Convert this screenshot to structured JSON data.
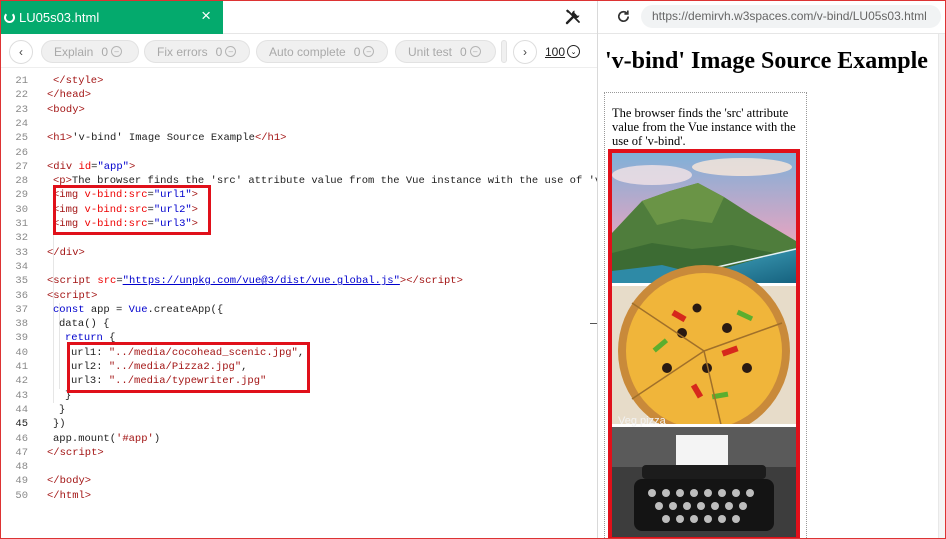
{
  "editor": {
    "tab_title": "LU05s03.html",
    "tab_close": "×",
    "tools_icon": "tools-icon"
  },
  "toolbar": {
    "prev": "‹",
    "next": "›",
    "buttons": [
      {
        "label": "Explain",
        "count": "0"
      },
      {
        "label": "Fix errors",
        "count": "0"
      },
      {
        "label": "Auto complete",
        "count": "0"
      },
      {
        "label": "Unit test",
        "count": "0"
      }
    ],
    "zoom": "100"
  },
  "code_lines": [
    {
      "n": "21",
      "indent": 1,
      "html": "<span class=\"t\">&lt;/style&gt;</span>"
    },
    {
      "n": "22",
      "indent": 0,
      "html": "<span class=\"t\">&lt;/head&gt;</span>"
    },
    {
      "n": "23",
      "indent": 0,
      "html": "<span class=\"t\">&lt;body&gt;</span>"
    },
    {
      "n": "24",
      "indent": 0,
      "html": ""
    },
    {
      "n": "25",
      "indent": 0,
      "html": "<span class=\"t\">&lt;h1&gt;</span>'v-bind' Image Source Example<span class=\"t\">&lt;/h1&gt;</span>"
    },
    {
      "n": "26",
      "indent": 0,
      "html": ""
    },
    {
      "n": "27",
      "indent": 0,
      "html": "<span class=\"t\">&lt;div</span> <span class=\"a\">id</span>=<span class=\"s\">\"app\"</span><span class=\"t\">&gt;</span>"
    },
    {
      "n": "28",
      "indent": 1,
      "html": "<span class=\"t\">&lt;p&gt;</span>The browser finds the 'src' attribute value from the Vue instance with the use of 'v-bind'.<span class=\"t\">&lt;/p&gt;</span>"
    },
    {
      "n": "29",
      "indent": 1,
      "html": "<span class=\"t\">&lt;img</span> <span class=\"a\">v-bind:src</span>=<span class=\"s\">\"url1\"</span><span class=\"t\">&gt;</span>"
    },
    {
      "n": "30",
      "indent": 1,
      "html": "<span class=\"t\">&lt;img</span> <span class=\"a\">v-bind:src</span>=<span class=\"s\">\"url2\"</span><span class=\"t\">&gt;</span>"
    },
    {
      "n": "31",
      "indent": 1,
      "html": "<span class=\"t\">&lt;img</span> <span class=\"a\">v-bind:src</span>=<span class=\"s\">\"url3\"</span><span class=\"t\">&gt;</span>"
    },
    {
      "n": "32",
      "indent": 0,
      "html": ""
    },
    {
      "n": "33",
      "indent": 0,
      "html": "<span class=\"t\">&lt;/div&gt;</span>"
    },
    {
      "n": "34",
      "indent": 0,
      "html": ""
    },
    {
      "n": "35",
      "indent": 0,
      "html": "<span class=\"t\">&lt;script</span> <span class=\"a\">src</span>=<span class=\"u\">\"https://unpkg.com/vue@3/dist/vue.global.js\"</span><span class=\"t\">&gt;&lt;/script&gt;</span>"
    },
    {
      "n": "36",
      "indent": 0,
      "html": "<span class=\"t\">&lt;script&gt;</span>"
    },
    {
      "n": "37",
      "indent": 1,
      "html": "<span class=\"k\">const</span> app = <span class=\"k\">Vue</span>.createApp({"
    },
    {
      "n": "38",
      "indent": 2,
      "html": "data() {"
    },
    {
      "n": "39",
      "indent": 3,
      "html": "<span class=\"k\">return</span> {"
    },
    {
      "n": "40",
      "indent": 4,
      "html": "url1: <span class=\"r\">\"../media/cocohead_scenic.jpg\"</span>,"
    },
    {
      "n": "41",
      "indent": 4,
      "html": "url2: <span class=\"r\">\"../media/Pizza2.jpg\"</span>,"
    },
    {
      "n": "42",
      "indent": 4,
      "html": "url3: <span class=\"r\">\"../media/typewriter.jpg\"</span>"
    },
    {
      "n": "43",
      "indent": 3,
      "html": "}"
    },
    {
      "n": "44",
      "indent": 2,
      "html": "}"
    },
    {
      "n": "45",
      "indent": 1,
      "html": "})",
      "current": true
    },
    {
      "n": "46",
      "indent": 1,
      "html": "app.mount(<span class=\"r\">'#app'</span>)"
    },
    {
      "n": "47",
      "indent": 0,
      "html": "<span class=\"t\">&lt;/script&gt;</span>"
    },
    {
      "n": "48",
      "indent": 0,
      "html": ""
    },
    {
      "n": "49",
      "indent": 0,
      "html": "<span class=\"t\">&lt;/body&gt;</span>"
    },
    {
      "n": "50",
      "indent": 0,
      "html": "<span class=\"t\">&lt;/html&gt;</span>"
    }
  ],
  "browser": {
    "url": "https://demirvh.w3spaces.com/v-bind/LU05s03.html",
    "reload_icon": "reload-icon"
  },
  "preview": {
    "heading": "'v-bind' Image Source Example",
    "paragraph": "The browser finds the 'src' attribute value from the Vue instance with the use of 'v-bind'.",
    "image_label": "Veg pizza",
    "images": [
      "landscape-image",
      "pizza-image",
      "typewriter-image"
    ]
  },
  "colors": {
    "tab_green": "#04aa6d",
    "highlight_red": "#e0101a"
  }
}
